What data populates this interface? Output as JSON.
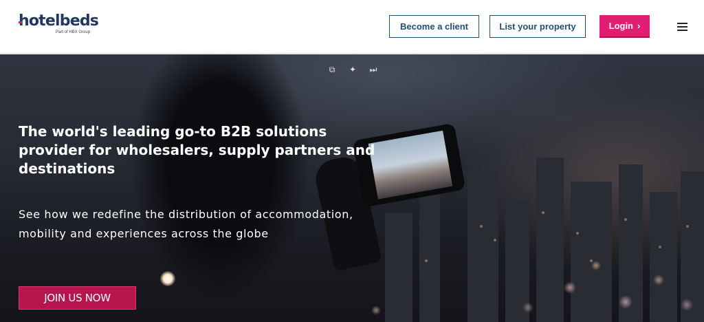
{
  "header": {
    "logo_text": "hotelbeds",
    "logo_tagline": "Part of HBX Group",
    "become_client_label": "Become a client",
    "list_property_label": "List your property",
    "login_label": "Login",
    "login_chevron": "›",
    "menu_icon": "hamburger-menu-icon"
  },
  "hero": {
    "video_controls": [
      {
        "icon": "picture-in-picture-icon",
        "glyph": "⧉"
      },
      {
        "icon": "sparkle-icon",
        "glyph": "✦"
      },
      {
        "icon": "skip-next-icon",
        "glyph": "⏭"
      }
    ],
    "headline": "The world's leading go-to B2B solutions provider for wholesalers, supply partners and destinations",
    "subheadline": "See how we redefine the distribution of accommodation, mobility and experiences across the globe",
    "cta_label": "JOIN US NOW"
  },
  "colors": {
    "brand_navy": "#1f3864",
    "brand_pink": "#e11d74",
    "cta_crimson": "#b8154e"
  }
}
